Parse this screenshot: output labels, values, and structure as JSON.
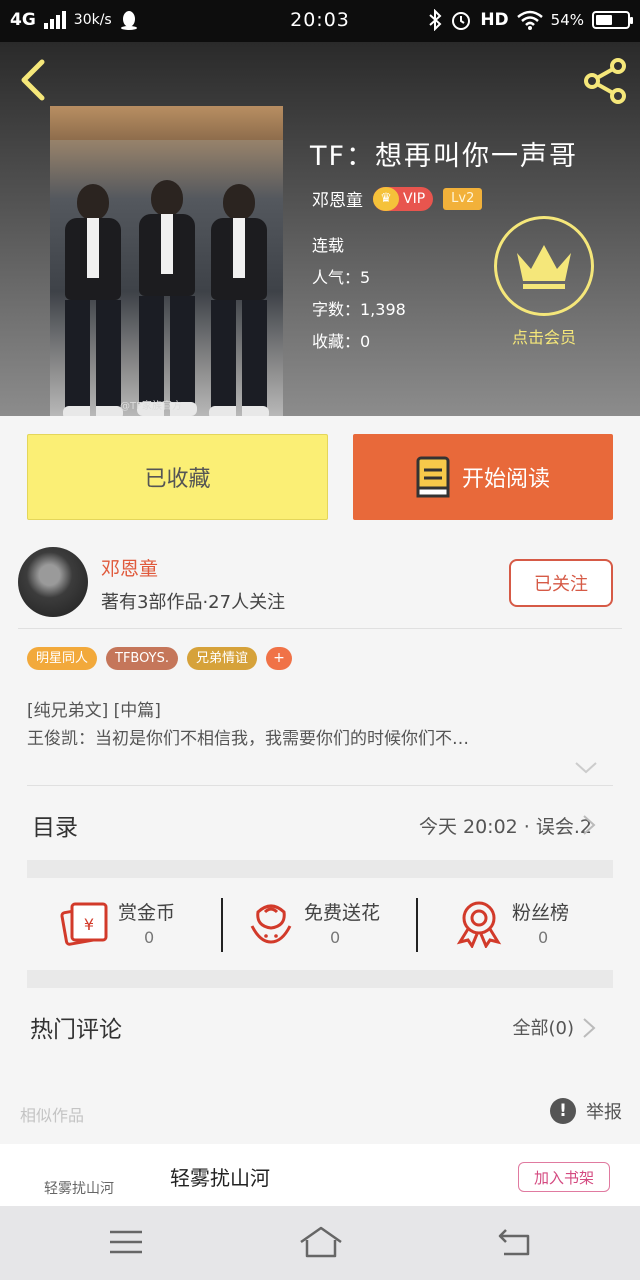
{
  "status_bar": {
    "network": "4G",
    "speed": "30k/s",
    "time": "20:03",
    "hd": "HD",
    "battery_percent": "54%",
    "battery_level": 0.54
  },
  "book": {
    "title": "TF：想再叫你一声哥",
    "author": "邓恩童",
    "vip_label": "VIP",
    "level": "Lv2",
    "status": "连载",
    "popularity": "人气：5",
    "word_count": "字数：1,398",
    "collections": "收藏：0",
    "cover_watermark": "@TF家族官方",
    "vip_member_label": "点击会员"
  },
  "actions": {
    "collected_label": "已收藏",
    "read_label": "开始阅读"
  },
  "author_info": {
    "name": "邓恩童",
    "stats": "著有3部作品·27人关注",
    "follow_label": "已关注"
  },
  "tags": [
    {
      "label": "明星同人",
      "color": "#f2a93b"
    },
    {
      "label": "TFBOYS.",
      "color": "#c5765a"
    },
    {
      "label": "兄弟情谊",
      "color": "#d6a23a"
    }
  ],
  "tag_more": "+",
  "intro": {
    "line1": "[纯兄弟文] [中篇]",
    "line2": "王俊凯：当初是你们不相信我，我需要你们的时候你们不…"
  },
  "catalog": {
    "label": "目录",
    "latest": "今天 20:02 · 误会.2"
  },
  "stats": [
    {
      "label": "赏金币",
      "count": "0",
      "icon": "red-envelope-icon"
    },
    {
      "label": "免费送花",
      "count": "0",
      "icon": "flower-icon"
    },
    {
      "label": "粉丝榜",
      "count": "0",
      "icon": "medal-icon"
    }
  ],
  "comments": {
    "label": "热门评论",
    "all": "全部(0)"
  },
  "similar": {
    "label": "相似作品",
    "report": "举报",
    "item": {
      "cover_text": "轻雾扰山河",
      "title": "轻雾扰山河",
      "shelf_label": "加入书架"
    }
  },
  "colors": {
    "accent_orange": "#e8693a",
    "collected_yellow": "#fbef75",
    "vip_gold": "#f5e77a",
    "author_red": "#e05a3c"
  }
}
